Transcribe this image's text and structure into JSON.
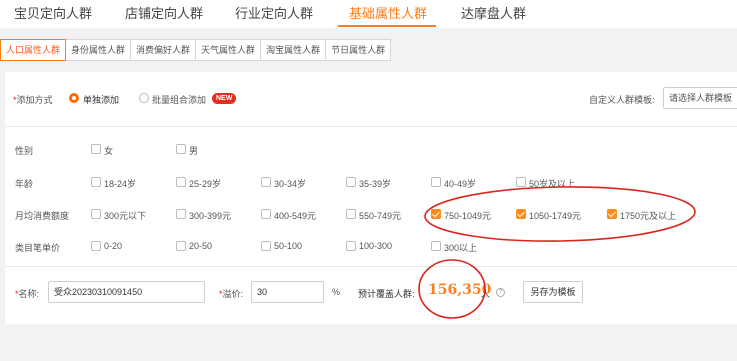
{
  "top_tabs": [
    {
      "label": "宝贝定向人群"
    },
    {
      "label": "店铺定向人群"
    },
    {
      "label": "行业定向人群"
    },
    {
      "label": "基础属性人群"
    },
    {
      "label": "达摩盘人群"
    }
  ],
  "active_top_tab": "基础属性人群",
  "sub_tabs": [
    {
      "label": "人口属性人群"
    },
    {
      "label": "身份属性人群"
    },
    {
      "label": "消费偏好人群"
    },
    {
      "label": "天气属性人群"
    },
    {
      "label": "淘宝属性人群"
    },
    {
      "label": "节日属性人群"
    }
  ],
  "add_mode": {
    "label": "添加方式",
    "options": [
      "单独添加",
      "批量组合添加"
    ],
    "selected": "单独添加",
    "new_badge": "NEW"
  },
  "template": {
    "label": "自定义人群模板:",
    "placeholder": "请选择人群模板"
  },
  "filters": {
    "gender": {
      "label": "性别",
      "options": [
        {
          "text": "女",
          "checked": false
        },
        {
          "text": "男",
          "checked": false
        }
      ]
    },
    "age": {
      "label": "年龄",
      "options": [
        {
          "text": "18-24岁",
          "checked": false
        },
        {
          "text": "25-29岁",
          "checked": false
        },
        {
          "text": "30-34岁",
          "checked": false
        },
        {
          "text": "35-39岁",
          "checked": false
        },
        {
          "text": "40-49岁",
          "checked": false
        },
        {
          "text": "50岁及以上",
          "checked": false
        }
      ]
    },
    "spend": {
      "label": "月均消费额度",
      "options": [
        {
          "text": "300元以下",
          "checked": false
        },
        {
          "text": "300-399元",
          "checked": false
        },
        {
          "text": "400-549元",
          "checked": false
        },
        {
          "text": "550-749元",
          "checked": false
        },
        {
          "text": "750-1049元",
          "checked": true
        },
        {
          "text": "1050-1749元",
          "checked": true
        },
        {
          "text": "1750元及以上",
          "checked": true
        }
      ]
    },
    "price": {
      "label": "类目笔单价",
      "options": [
        {
          "text": "0-20",
          "checked": false
        },
        {
          "text": "20-50",
          "checked": false
        },
        {
          "text": "50-100",
          "checked": false
        },
        {
          "text": "100-300",
          "checked": false
        },
        {
          "text": "300以上",
          "checked": false
        }
      ]
    }
  },
  "bottom": {
    "name_label": "名称:",
    "name_value": "受众20230310091450",
    "premium_label": "溢价:",
    "premium_value": "30",
    "percent": "%",
    "coverage_label": "预计覆盖人群:",
    "coverage_value": "156,350",
    "coverage_unit": "人",
    "help_glyph": "?",
    "save_button": "另存为模板"
  },
  "colors": {
    "accent": "#ff7d1a",
    "annotation_red": "#d9261c"
  }
}
